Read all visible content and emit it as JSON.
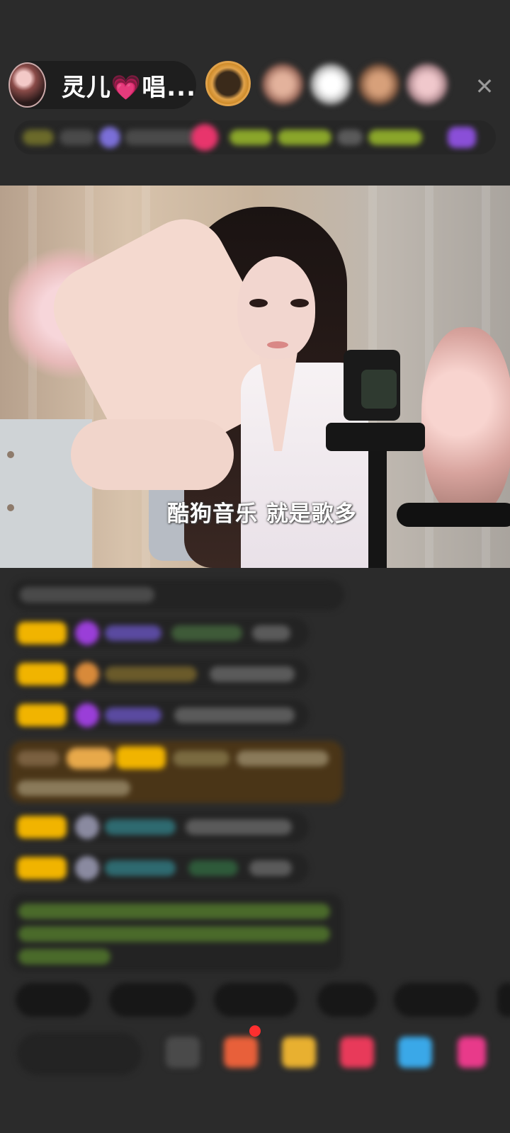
{
  "header": {
    "host_name": "灵儿💗唱...",
    "avatar": "host-avatar",
    "viewers": [
      {
        "icon": "viewer-avatar-1",
        "color": "#c58a3b"
      },
      {
        "icon": "viewer-avatar-2",
        "color": "#b07a66"
      },
      {
        "icon": "viewer-avatar-3",
        "color": "#e7e7e7"
      },
      {
        "icon": "viewer-avatar-4",
        "color": "#a87854"
      },
      {
        "icon": "viewer-avatar-5",
        "color": "#d3a7ad"
      }
    ],
    "close_icon": "close-icon",
    "close_glyph": "✕"
  },
  "video": {
    "subtitle": "酷狗音乐 就是歌多"
  },
  "chat": {
    "badge_color": "#f1b400",
    "gold_highlight_color": "#4a3517",
    "green_text_color": "#6fbf3a"
  },
  "colors": {
    "background": "#2b2b2b",
    "badge_yellow": "#f1b400"
  }
}
